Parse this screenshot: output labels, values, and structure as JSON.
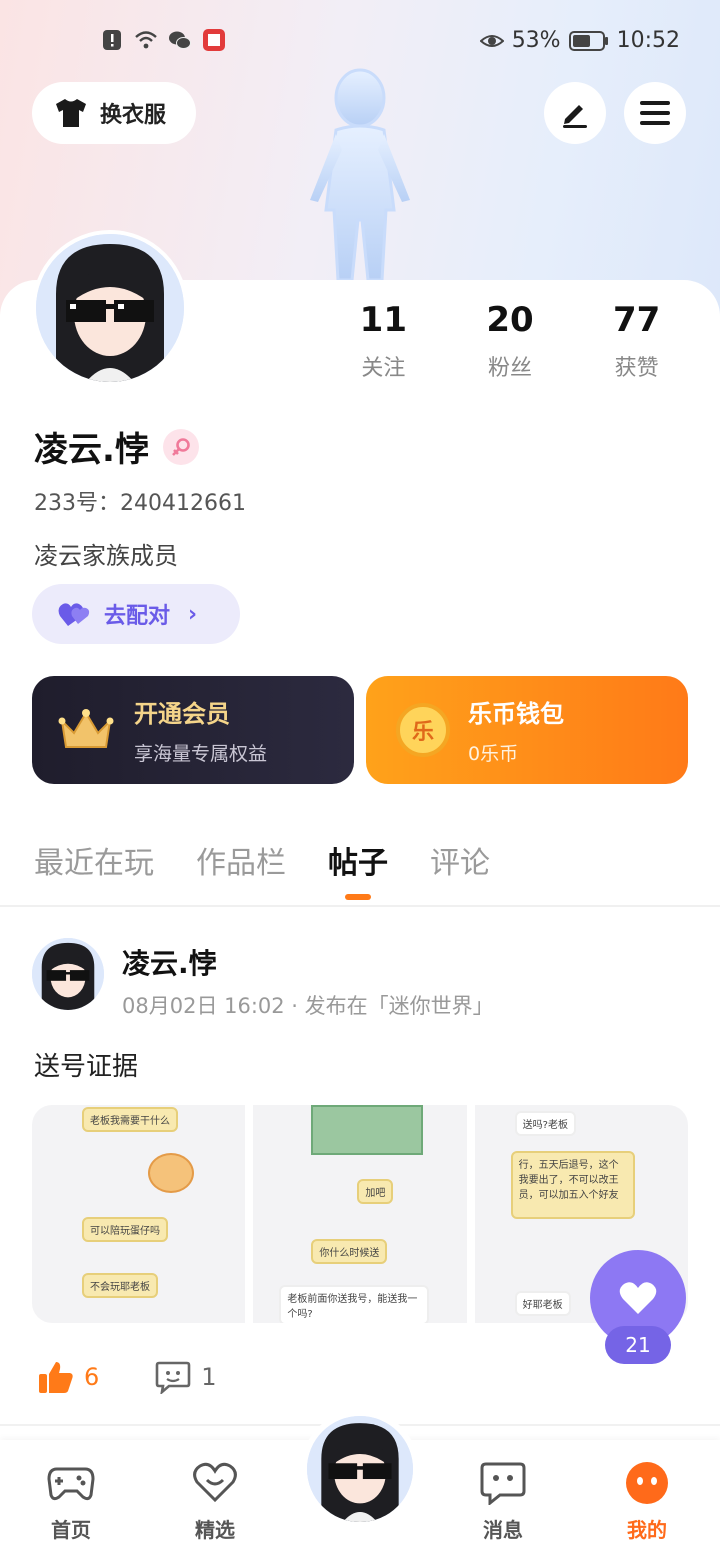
{
  "status_bar": {
    "battery": "53%",
    "time": "10:52"
  },
  "top": {
    "outfit_label": "换衣服"
  },
  "profile": {
    "nickname": "凌云.悖",
    "uid": "233号：240412661",
    "bio": "凌云家族成员",
    "stats": [
      {
        "value": "11",
        "label": "关注"
      },
      {
        "value": "20",
        "label": "粉丝"
      },
      {
        "value": "77",
        "label": "获赞"
      }
    ],
    "pair_label": "去配对"
  },
  "cards": {
    "vip": {
      "title": "开通会员",
      "subtitle": "享海量专属权益"
    },
    "wallet": {
      "title": "乐币钱包",
      "subtitle": "0乐币",
      "coin_glyph": "乐"
    }
  },
  "tabs": [
    "最近在玩",
    "作品栏",
    "帖子",
    "评论"
  ],
  "post": {
    "author": "凌云.悖",
    "meta": "08月02日 16:02 · 发布在「迷你世界」",
    "text": "送号证据",
    "shots": {
      "s1": [
        "老板我需要干什么",
        "可以陪玩蛋仔吗",
        "不会玩耶老板"
      ],
      "s2": [
        "加吧",
        "你什么时候送",
        "老板前面你送我号，能送我一个吗?"
      ],
      "s3": [
        "送吗?老板",
        "行，五天后退号，这个我要出了，不可以改王员，可以加五入个好友",
        "好耶老板"
      ]
    },
    "likes": "6",
    "comments": "1",
    "fab_count": "21"
  },
  "bottom_nav": [
    "首页",
    "精选",
    "消息",
    "我的"
  ],
  "colors": {
    "accent": "#ff7a18",
    "purple": "#7564e6"
  }
}
